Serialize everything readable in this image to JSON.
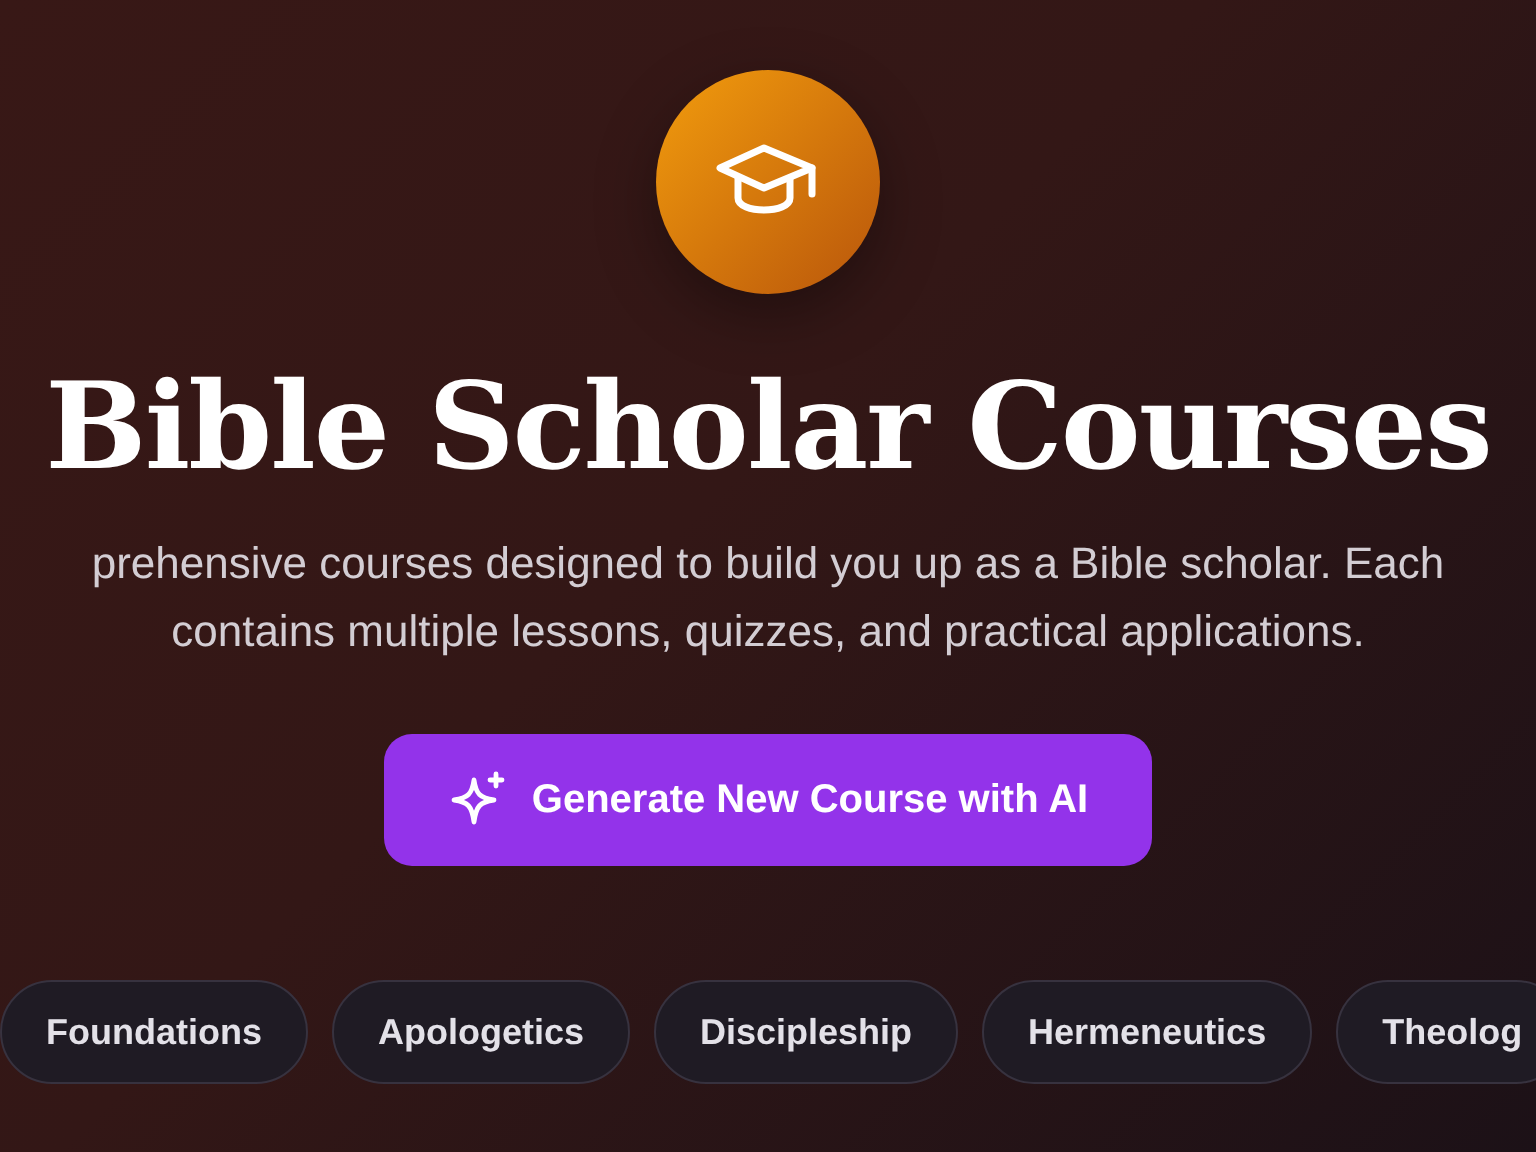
{
  "title": "Bible Scholar Courses",
  "subtitle_lines": [
    "prehensive courses designed to build you up as a Bible scholar. Each",
    "contains multiple lessons, quizzes, and practical applications."
  ],
  "generate_button": {
    "label": "Generate New Course with AI"
  },
  "categories": [
    {
      "label": "Foundations"
    },
    {
      "label": "Apologetics"
    },
    {
      "label": "Discipleship"
    },
    {
      "label": "Hermeneutics"
    },
    {
      "label": "Theolog"
    }
  ]
}
